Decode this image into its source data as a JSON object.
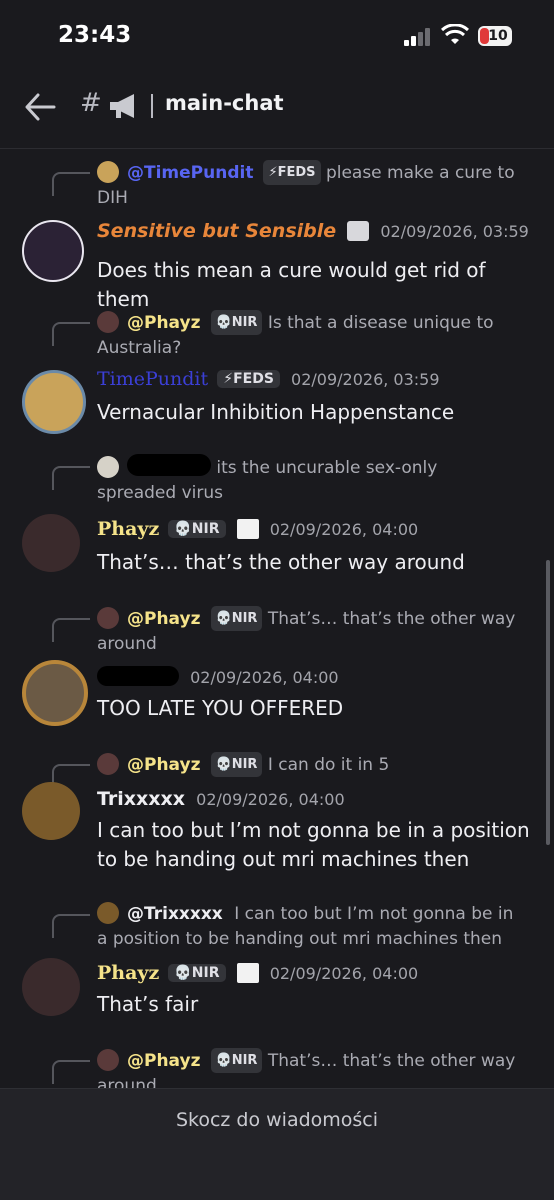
{
  "status_bar": {
    "time": "23:43",
    "battery": "10"
  },
  "header": {
    "hash": "#",
    "channel_name": "main-chat"
  },
  "messages": [
    {
      "reply": {
        "author": "@TimePundit",
        "role": "FEDS",
        "text": "please make a cure to DIH"
      },
      "author": "Sensitive but Sensible",
      "timestamp": "02/09/2026, 03:59",
      "content": "Does this mean a cure would get rid of them"
    },
    {
      "reply": {
        "author": "@Phayz",
        "role": "NIR",
        "text": "Is that a disease unique to Australia?"
      },
      "author": "TimePundit",
      "role": "FEDS",
      "timestamp": "02/09/2026, 03:59",
      "content": "Vernacular Inhibition Happenstance"
    },
    {
      "reply": {
        "text": "its the uncurable sex-only spreaded virus"
      },
      "author": "Phayz",
      "role": "NIR",
      "timestamp": "02/09/2026, 04:00",
      "content": "That’s… that’s the other way around"
    },
    {
      "reply": {
        "author": "@Phayz",
        "role": "NIR",
        "text": "That’s… that’s the other way around"
      },
      "timestamp": "02/09/2026, 04:00",
      "content": "TOO LATE YOU OFFERED"
    },
    {
      "reply": {
        "author": "@Phayz",
        "role": "NIR",
        "text": "I can do it in 5"
      },
      "author": "Trixxxxx",
      "timestamp": "02/09/2026, 04:00",
      "content": "I can too but I’m not gonna be in a position to be handing out mri machines then"
    },
    {
      "reply": {
        "author": "@Trixxxxx",
        "text": "I can too but I’m not gonna be in a position to be handing out mri machines then"
      },
      "author": "Phayz",
      "role": "NIR",
      "timestamp": "02/09/2026, 04:00",
      "content": "That’s fair"
    },
    {
      "reply": {
        "author": "@Phayz",
        "role": "NIR",
        "text": "That’s… that’s the other way around"
      }
    }
  ],
  "jump_bar": {
    "label": "Skocz do wiadomości"
  },
  "colors": {
    "background": "#1a1a1e",
    "phayz": "#f5e38a",
    "sensitive": "#e8863a",
    "timepundit": "#3b3fd6",
    "link_reply": "#5865f2"
  }
}
